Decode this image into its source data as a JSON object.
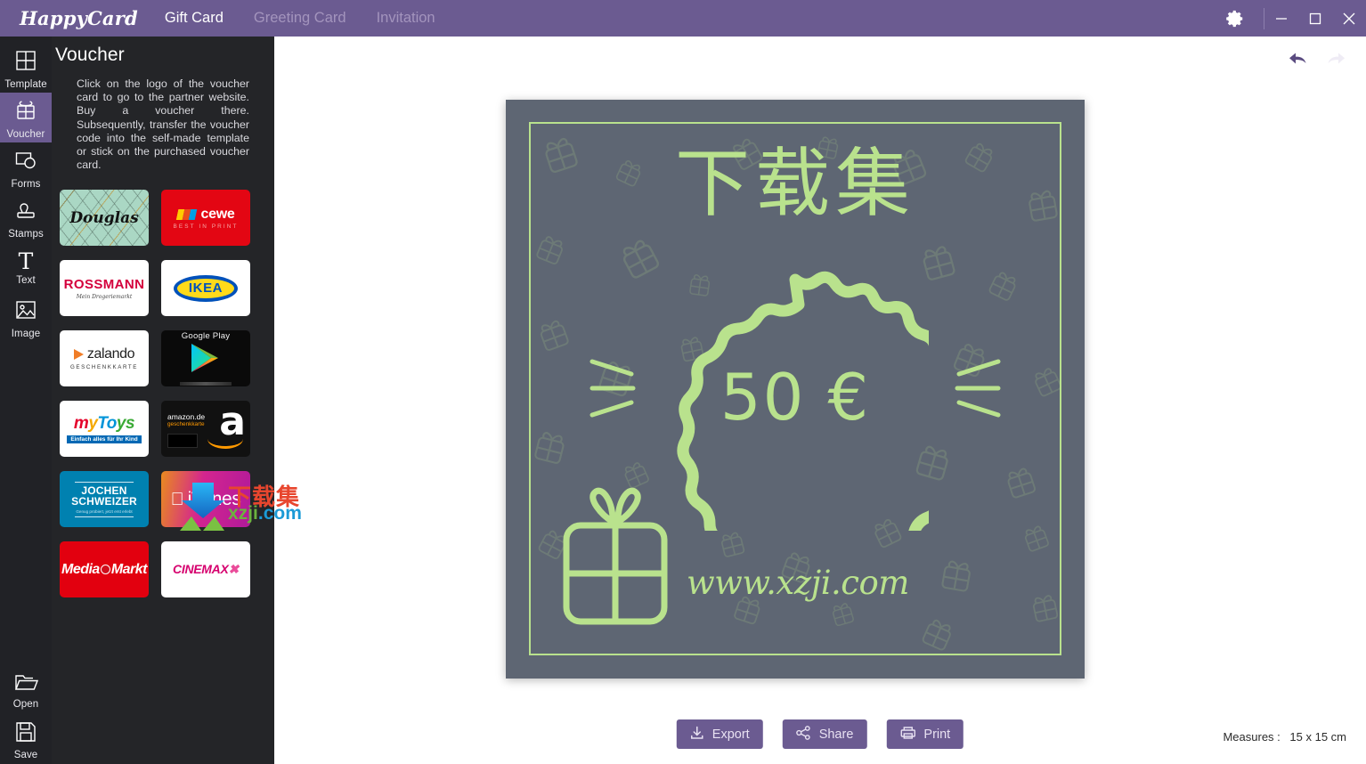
{
  "titlebar": {
    "brand": "HappyCard",
    "tabs": [
      {
        "label": "Gift Card",
        "active": true
      },
      {
        "label": "Greeting Card",
        "active": false
      },
      {
        "label": "Invitation",
        "active": false
      }
    ],
    "gear_icon": "gear-icon",
    "minimize_icon": "minimize-icon",
    "maximize_icon": "maximize-icon",
    "close_icon": "close-icon",
    "accent_color": "#6b5b91"
  },
  "rail": {
    "items": [
      {
        "label": "Template",
        "icon": "grid-icon",
        "active": false
      },
      {
        "label": "Voucher",
        "icon": "gift-icon",
        "active": true
      },
      {
        "label": "Forms",
        "icon": "shapes-icon",
        "active": false
      },
      {
        "label": "Stamps",
        "icon": "stamp-icon",
        "active": false
      },
      {
        "label": "Text",
        "icon": "text-t-icon",
        "active": false
      },
      {
        "label": "Image",
        "icon": "image-icon",
        "active": false
      }
    ],
    "bottom_items": [
      {
        "label": "Open",
        "icon": "folder-open-icon"
      },
      {
        "label": "Save",
        "icon": "floppy-disk-icon"
      }
    ]
  },
  "panel": {
    "title": "Voucher",
    "description": "Click on the logo of the voucher card to go to the partner website. Buy a voucher there. Subsequently, transfer the voucher code into the self-made template or stick on the purchased voucher card.",
    "collapse_icon": "chevron-left-icon",
    "tiles": [
      {
        "name": "douglas",
        "brand": "Douglas"
      },
      {
        "name": "cewe",
        "brand": "cewe",
        "tagline": "BEST IN PRINT"
      },
      {
        "name": "rossmann",
        "brand": "ROSSMANN",
        "tagline": "Mein Drogeriemarkt"
      },
      {
        "name": "ikea",
        "brand": "IKEA"
      },
      {
        "name": "zalando",
        "brand": "zalando",
        "tagline": "GESCHENKKARTE"
      },
      {
        "name": "google-play",
        "brand": "Google Play"
      },
      {
        "name": "mytoys",
        "brand": "myToys",
        "tagline": "Einfach alles für Ihr Kind"
      },
      {
        "name": "amazon",
        "brand": "amazon.de",
        "tagline": "geschenkkarte",
        "wordmark": "a"
      },
      {
        "name": "jochen-schweizer",
        "brand": "JOCHEN SCHWEIZER",
        "tagline": "Genug probiert, jetzt erst erlebt"
      },
      {
        "name": "itunes",
        "brand": "iTunes",
        "apple_icon": "apple-icon"
      },
      {
        "name": "media-markt",
        "brand_a": "Media",
        "brand_b": "Markt"
      },
      {
        "name": "cinemax",
        "brand": "Cinemax"
      }
    ]
  },
  "toolbar": {
    "undo_icon": "undo-icon",
    "redo_icon": "redo-icon"
  },
  "card": {
    "title": "下载集",
    "amount": "50 €",
    "url": "www.xzji.com",
    "background_color": "#5e6673",
    "accent_color": "#b9e28d",
    "pattern_icon": "gift-box-pattern",
    "badge_icon": "scalloped-seal-icon",
    "gift_icon": "gift-box-icon"
  },
  "bottom": {
    "buttons": [
      {
        "label": "Export",
        "icon": "download-icon"
      },
      {
        "label": "Share",
        "icon": "share-nodes-icon"
      },
      {
        "label": "Print",
        "icon": "printer-icon"
      }
    ],
    "measures_label": "Measures :",
    "measures_value": "15 x 15 cm"
  },
  "watermark": {
    "cn": "下载集",
    "url_a": "xzji",
    "url_b": ".com",
    "logo_icon": "download-arrow-logo"
  }
}
